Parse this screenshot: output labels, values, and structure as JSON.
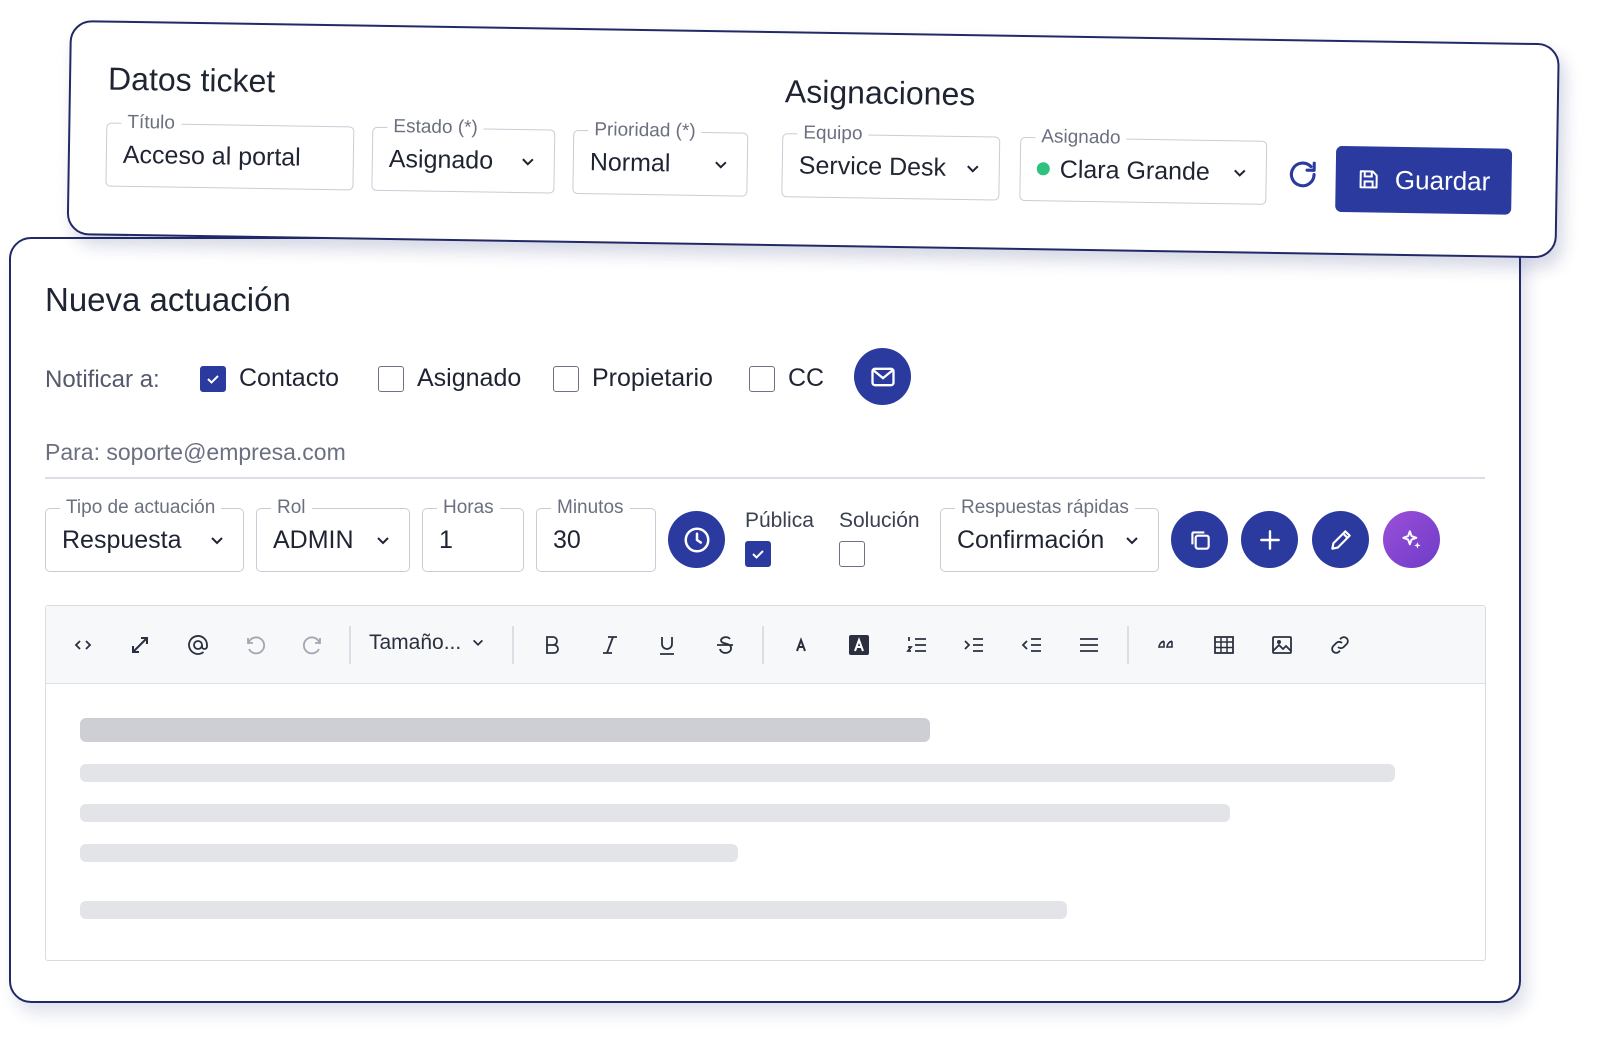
{
  "ticket": {
    "heading": "Datos ticket",
    "titulo": {
      "label": "Título",
      "value": "Acceso al portal"
    },
    "estado": {
      "label": "Estado (*)",
      "value": "Asignado"
    },
    "prioridad": {
      "label": "Prioridad (*)",
      "value": "Normal"
    }
  },
  "asignaciones": {
    "heading": "Asignaciones",
    "equipo": {
      "label": "Equipo",
      "value": "Service Desk"
    },
    "asignado": {
      "label": "Asignado",
      "value": "Clara Grande",
      "status_color": "#2ec27e"
    },
    "save_label": "Guardar"
  },
  "actuacion": {
    "heading": "Nueva actuación",
    "notify_label": "Notificar a:",
    "notify_options": [
      {
        "label": "Contacto",
        "checked": true
      },
      {
        "label": "Asignado",
        "checked": false
      },
      {
        "label": "Propietario",
        "checked": false
      },
      {
        "label": "CC",
        "checked": false
      }
    ],
    "para": "Para: soporte@empresa.com",
    "tipo": {
      "label": "Tipo de actuación",
      "value": "Respuesta"
    },
    "rol": {
      "label": "Rol",
      "value": "ADMIN"
    },
    "horas": {
      "label": "Horas",
      "value": "1"
    },
    "minutos": {
      "label": "Minutos",
      "value": "30"
    },
    "publica": {
      "label": "Pública",
      "checked": true
    },
    "solucion": {
      "label": "Solución",
      "checked": false
    },
    "respuestas": {
      "label": "Respuestas rápidas",
      "value": "Confirmación"
    }
  },
  "editor": {
    "size_label": "Tamaño...",
    "tools": [
      "code-icon",
      "expand-icon",
      "mention-icon",
      "undo-icon",
      "redo-icon",
      "bold-icon",
      "italic-icon",
      "underline-icon",
      "strikethrough-icon",
      "font-color-icon",
      "highlight-icon",
      "ordered-list-icon",
      "indent-icon",
      "outdent-icon",
      "align-icon",
      "quote-icon",
      "table-icon",
      "image-icon",
      "link-icon"
    ]
  },
  "colors": {
    "primary": "#2a3a9e",
    "border": "#222a66",
    "accent_purple": "#8a45d2"
  }
}
